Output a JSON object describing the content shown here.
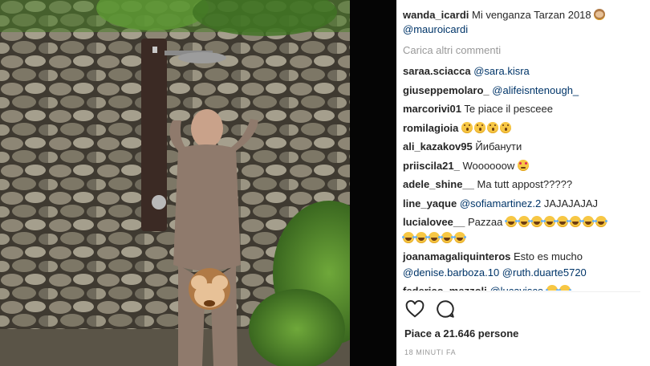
{
  "photo": {
    "alt": "",
    "palette": {
      "stone_dark": "#4f4a3f",
      "stone_light": "#a59f8d",
      "grass": "#4d7f2a",
      "pipe": "#3b2a24",
      "skin": "#c9a28a",
      "emoji": "#b07a46"
    }
  },
  "caption": {
    "username": "wanda_icardi",
    "text": "Mi venganza Tarzan 2018",
    "emoji": "monkey-icon",
    "mention": "@mauroicardi"
  },
  "load_more": "Carica altri commenti",
  "comments": [
    {
      "user": "saraa.sciacca",
      "text": "",
      "mention": "@sara.kisra",
      "emoji_kind": "",
      "emoji_count": 0
    },
    {
      "user": "giuseppemolaro_",
      "text": "",
      "mention": "@alifeisntenough_",
      "emoji_kind": "",
      "emoji_count": 0
    },
    {
      "user": "marcorivi01",
      "text": "Te piace il pesceee",
      "mention": "",
      "emoji_kind": "",
      "emoji_count": 0
    },
    {
      "user": "romilagioia",
      "text": "",
      "mention": "",
      "emoji_kind": "wow",
      "emoji_count": 4
    },
    {
      "user": "ali_kazakov95",
      "text": "Йибанути",
      "mention": "",
      "emoji_kind": "",
      "emoji_count": 0
    },
    {
      "user": "priiscila21_",
      "text": "Woooooow",
      "mention": "",
      "emoji_kind": "heart",
      "emoji_count": 1
    },
    {
      "user": "adele_shine__",
      "text": "Ma tutt appost?????",
      "mention": "",
      "emoji_kind": "",
      "emoji_count": 0
    },
    {
      "user": "line_yaque",
      "text": "JAJAJAJAJ",
      "mention": "@sofiamartinez.2",
      "emoji_kind": "",
      "emoji_count": 0
    },
    {
      "user": "lucialovee__",
      "text": "Pazzaa",
      "mention": "",
      "emoji_kind": "laugh",
      "emoji_count": 13
    },
    {
      "user": "joanamagaliquinteros",
      "text": "Esto es mucho",
      "mention": "",
      "emoji_kind": "",
      "emoji_count": 0,
      "line2": [
        "@denise.barboza.10",
        "@ruth.duarte5720"
      ]
    },
    {
      "user": "federico_mazzoli",
      "text": "",
      "mention": "@lucavisco",
      "emoji_kind": "laugh",
      "emoji_count": 2
    }
  ],
  "actions": {
    "like_icon": "heart-outline-icon",
    "comment_icon": "comment-bubble-icon"
  },
  "likes": "Piace a 21.646 persone",
  "timestamp": "18 MINUTI FA"
}
